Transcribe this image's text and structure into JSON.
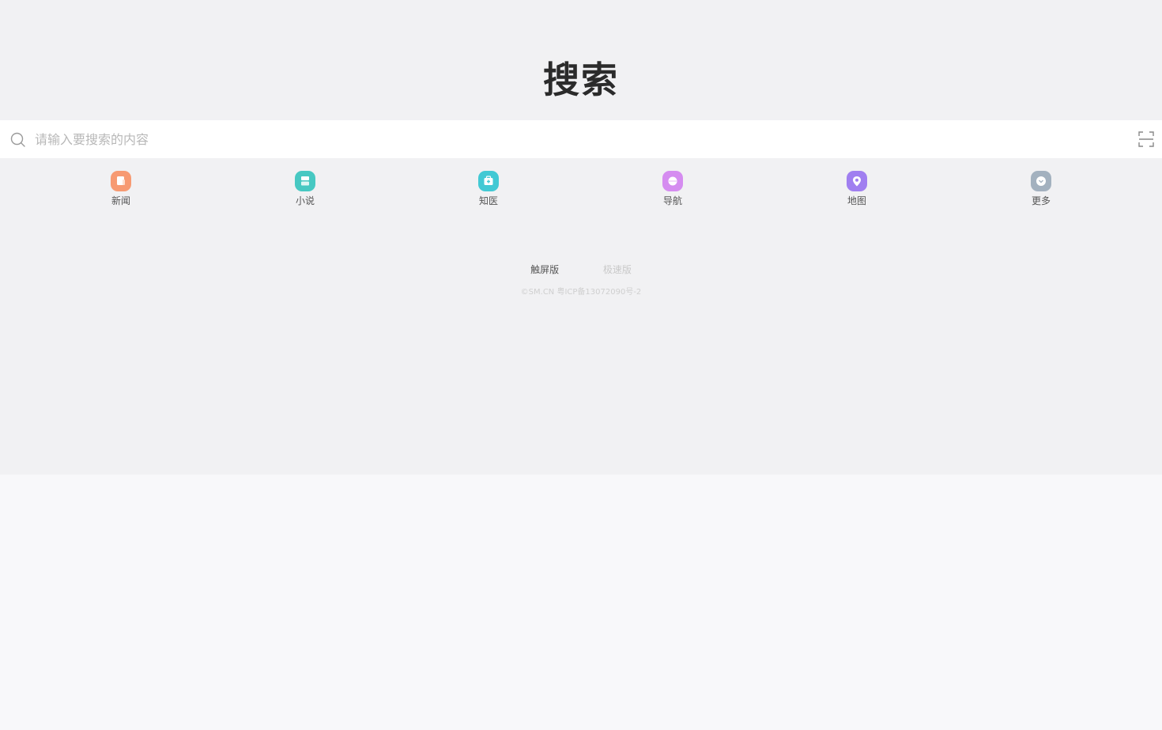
{
  "brand": {
    "logo_text": "搜索"
  },
  "search": {
    "placeholder": "请输入要搜索的内容"
  },
  "quick_links": [
    {
      "label": "新闻",
      "icon": "news-icon",
      "color": "#f79a72"
    },
    {
      "label": "小说",
      "icon": "novel-icon",
      "color": "#47c8c2"
    },
    {
      "label": "知医",
      "icon": "medical-icon",
      "color": "#42c9d4"
    },
    {
      "label": "导航",
      "icon": "navigation-icon",
      "color": "#d58cf0"
    },
    {
      "label": "地图",
      "icon": "map-icon",
      "color": "#a07ff0"
    },
    {
      "label": "更多",
      "icon": "more-icon",
      "color": "#a3b1bf"
    }
  ],
  "footer": {
    "touch_version": "触屏版",
    "lite_version": "极速版",
    "copyright": "©SM.CN 粤ICP备13072090号-2"
  }
}
